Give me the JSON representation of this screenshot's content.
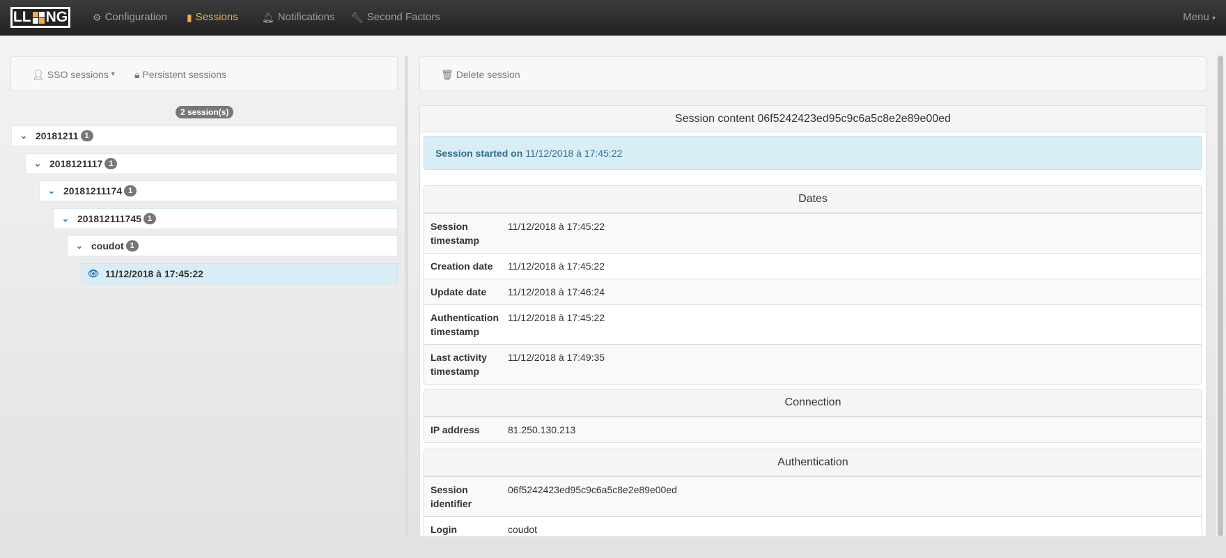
{
  "nav": {
    "brand": "LLNG",
    "items": [
      {
        "label": "Configuration",
        "icon": "gear-icon"
      },
      {
        "label": "Sessions",
        "icon": "documents-icon"
      },
      {
        "label": "Notifications",
        "icon": "bell-icon"
      },
      {
        "label": "Second Factors",
        "icon": "wrench-icon"
      }
    ],
    "menu": "Menu"
  },
  "left_toolbar": {
    "sso": "SSO sessions",
    "persistent": "Persistent sessions"
  },
  "session_count": "2 session(s)",
  "tree": [
    {
      "label": "20181211",
      "count": "1"
    },
    {
      "label": "2018121117",
      "count": "1"
    },
    {
      "label": "20181211174",
      "count": "1"
    },
    {
      "label": "201812111745",
      "count": "1"
    },
    {
      "label": "coudot",
      "count": "1"
    },
    {
      "label": "11/12/2018 à 17:45:22"
    }
  ],
  "right_toolbar": {
    "delete": "Delete session"
  },
  "session": {
    "title": "Session content 06f5242423ed95c9c6a5c8e2e89e00ed",
    "started_label": "Session started on",
    "started_value": "11/12/2018 à 17:45:22",
    "sections": [
      {
        "title": "Dates",
        "rows": [
          {
            "k": "Session timestamp",
            "v": "11/12/2018 à 17:45:22"
          },
          {
            "k": "Creation date",
            "v": "11/12/2018 à 17:45:22"
          },
          {
            "k": "Update date",
            "v": "11/12/2018 à 17:46:24"
          },
          {
            "k": "Authentication timestamp",
            "v": "11/12/2018 à 17:45:22"
          },
          {
            "k": "Last activity timestamp",
            "v": "11/12/2018 à 17:49:35"
          }
        ]
      },
      {
        "title": "Connection",
        "rows": [
          {
            "k": "IP address",
            "v": "81.250.130.213"
          }
        ]
      },
      {
        "title": "Authentication",
        "rows": [
          {
            "k": "Session identifier",
            "v": "06f5242423ed95c9c6a5c8e2e89e00ed"
          },
          {
            "k": "Login",
            "v": "coudot"
          }
        ]
      }
    ]
  }
}
